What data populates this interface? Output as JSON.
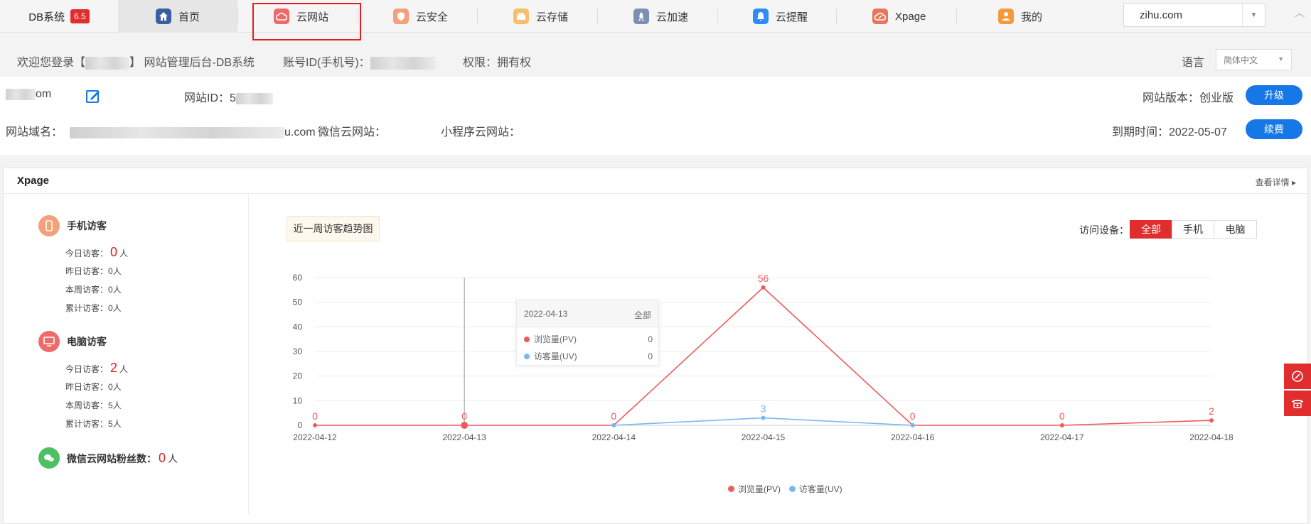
{
  "brand": {
    "name": "DB系统",
    "version": "6.5"
  },
  "nav": {
    "items": [
      {
        "label": "首页",
        "icon": "home-icon",
        "color": "#3a5fa0"
      },
      {
        "label": "云网站",
        "icon": "cloud-site-icon",
        "color": "#ee6a6a"
      },
      {
        "label": "云安全",
        "icon": "shield-icon",
        "color": "#f3a07b"
      },
      {
        "label": "云存储",
        "icon": "storage-icon",
        "color": "#f6c06a"
      },
      {
        "label": "云加速",
        "icon": "rocket-icon",
        "color": "#7a8fb2"
      },
      {
        "label": "云提醒",
        "icon": "bell-icon",
        "color": "#2f8cf5"
      },
      {
        "label": "Xpage",
        "icon": "xpage-icon",
        "color": "#e8755a"
      },
      {
        "label": "我的",
        "icon": "user-icon",
        "color": "#f39a3c"
      }
    ],
    "active_index": 0,
    "highlighted_index": 1,
    "site_select": "zihu.com"
  },
  "welcome": {
    "prefix": "欢迎您登录【",
    "suffix": "】 网站管理后台-DB系统",
    "account_label": "账号ID(手机号)：",
    "permission": "权限：拥有权",
    "lang_label": "语言",
    "lang_value": "简体中文"
  },
  "site": {
    "name_suffix": "om",
    "site_id_label": "网站ID：",
    "site_id_partial": "5",
    "domain_label": "网站域名：",
    "domain_suffix": "u.com",
    "wechat_label": "微信云网站：",
    "miniprogram_label": "小程序云网站：",
    "version_label": "网站版本：创业版",
    "upgrade_label": "升级",
    "expire_label": "到期时间：2022-05-07",
    "renew_label": "续费"
  },
  "xpage": {
    "title": "Xpage",
    "more": "查看详情",
    "mobile": {
      "title": "手机访客",
      "today_label": "今日访客：",
      "today": "0",
      "unit": "人",
      "yesterday": "昨日访客：0人",
      "week": "本周访客：0人",
      "total": "累计访客：0人"
    },
    "pc": {
      "title": "电脑访客",
      "today_label": "今日访客：",
      "today": "2",
      "unit": "人",
      "yesterday": "昨日访客：0人",
      "week": "本周访客：5人",
      "total": "累计访客：5人"
    },
    "wechat": {
      "label": "微信云网站粉丝数：",
      "count": "0",
      "unit": "人"
    },
    "chart_button": "近一周访客趋势图",
    "device_label": "访问设备：",
    "device_options": [
      "全部",
      "手机",
      "电脑"
    ],
    "device_selected": "全部",
    "tooltip": {
      "date": "2022-04-13",
      "scope": "全部",
      "pv_label": "浏览量(PV)",
      "pv": "0",
      "uv_label": "访客量(UV)",
      "uv": "0"
    }
  },
  "chart_data": {
    "type": "line",
    "x": [
      "2022-04-12",
      "2022-04-13",
      "2022-04-14",
      "2022-04-15",
      "2022-04-16",
      "2022-04-17",
      "2022-04-18"
    ],
    "series": [
      {
        "name": "浏览量(PV)",
        "values": [
          0,
          0,
          0,
          56,
          0,
          0,
          2
        ],
        "color": "#ef5b5b",
        "labels": [
          "0",
          "0",
          "0",
          "56",
          "0",
          "0",
          "2"
        ]
      },
      {
        "name": "访客量(UV)",
        "values": [
          null,
          null,
          0,
          3,
          0,
          null,
          null
        ],
        "color": "#7ab8f5",
        "labels": [
          "",
          "",
          "",
          "3",
          "",
          "",
          ""
        ]
      }
    ],
    "yticks": [
      "0",
      "10",
      "20",
      "30",
      "40",
      "50",
      "60"
    ],
    "ylim": [
      0,
      60
    ],
    "grid": true,
    "legend_position": "bottom-center",
    "hover_index": 1
  }
}
